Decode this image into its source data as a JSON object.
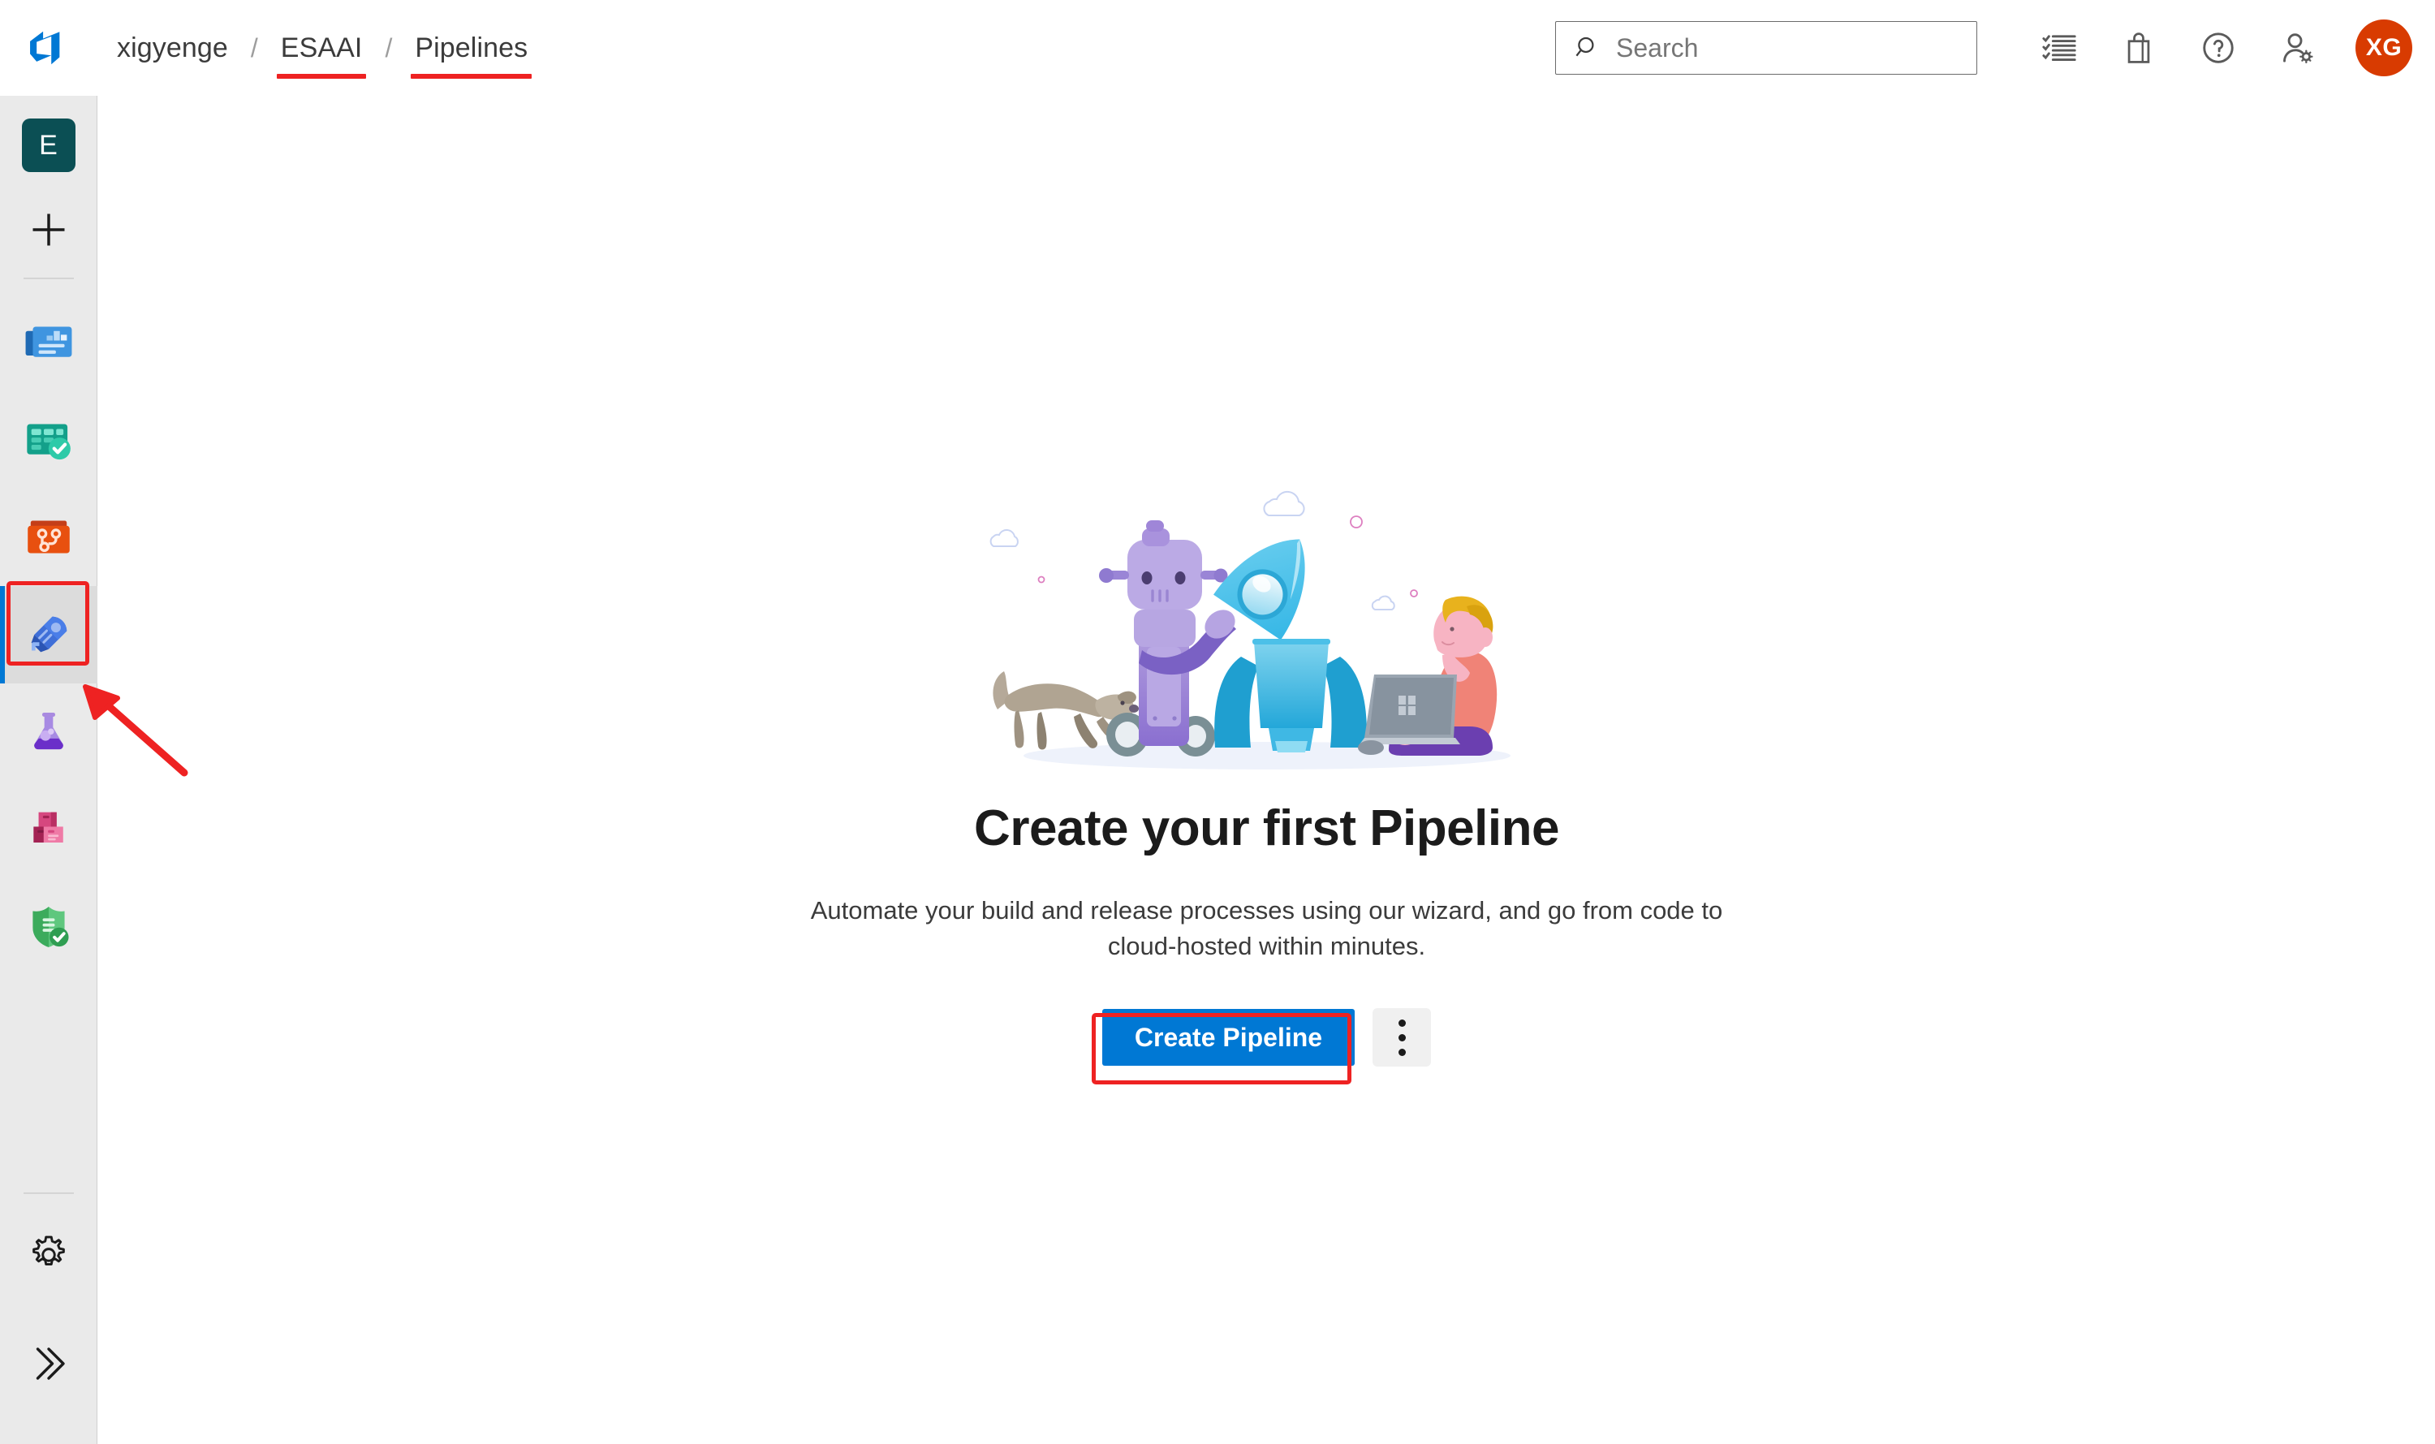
{
  "header": {
    "logo_icon": "azure-devops-logo",
    "breadcrumb": {
      "org": "xigyenge",
      "separator1": "/",
      "project": "ESAAI",
      "separator2": "/",
      "section": "Pipelines"
    },
    "search": {
      "placeholder": "Search",
      "value": "",
      "icon": "search-icon"
    },
    "actions": [
      {
        "name": "checklist-icon",
        "label": "Boards checklist"
      },
      {
        "name": "shopping-bag-icon",
        "label": "Marketplace"
      },
      {
        "name": "help-icon",
        "label": "Help"
      },
      {
        "name": "user-settings-icon",
        "label": "User settings"
      }
    ],
    "avatar": {
      "initials": "XG",
      "color": "#d83b01"
    }
  },
  "sidebar": {
    "project_avatar": {
      "initials": "E",
      "color": "#0b4f54"
    },
    "new_button": {
      "icon": "plus-icon",
      "label": "New"
    },
    "items": [
      {
        "label": "Overview",
        "icon": "overview-icon",
        "selected": false
      },
      {
        "label": "Boards",
        "icon": "boards-icon",
        "selected": false
      },
      {
        "label": "Repos",
        "icon": "repos-icon",
        "selected": false
      },
      {
        "label": "Pipelines",
        "icon": "pipelines-rocket-icon",
        "selected": true
      },
      {
        "label": "Test Plans",
        "icon": "test-plans-flask-icon",
        "selected": false
      },
      {
        "label": "Artifacts",
        "icon": "artifacts-boxes-icon",
        "selected": false
      },
      {
        "label": "Advanced Security",
        "icon": "shield-check-icon",
        "selected": false
      }
    ],
    "project_settings": {
      "label": "Project settings",
      "icon": "gear-icon"
    },
    "expand": {
      "label": "Expand",
      "icon": "double-chevron-right-icon"
    }
  },
  "main": {
    "illustration": "robot-rocket-dog-developer-illustration",
    "title": "Create your first Pipeline",
    "description": "Automate your build and release processes using our wizard, and go from code to cloud-hosted within minutes.",
    "primary_button": {
      "label": "Create Pipeline",
      "color": "#0078d4"
    },
    "more_button": {
      "label": "More options",
      "icon": "more-vertical-icon"
    }
  },
  "annotations": {
    "color": "#ee2222",
    "items": [
      {
        "name": "underline-project",
        "target": "ESAAI"
      },
      {
        "name": "underline-section",
        "target": "Pipelines"
      },
      {
        "name": "box-pipelines-nav",
        "target": "Pipelines sidebar icon"
      },
      {
        "name": "arrow-to-pipelines-nav",
        "target": "Pipelines sidebar icon"
      },
      {
        "name": "box-create-pipeline",
        "target": "Create Pipeline button"
      }
    ]
  }
}
